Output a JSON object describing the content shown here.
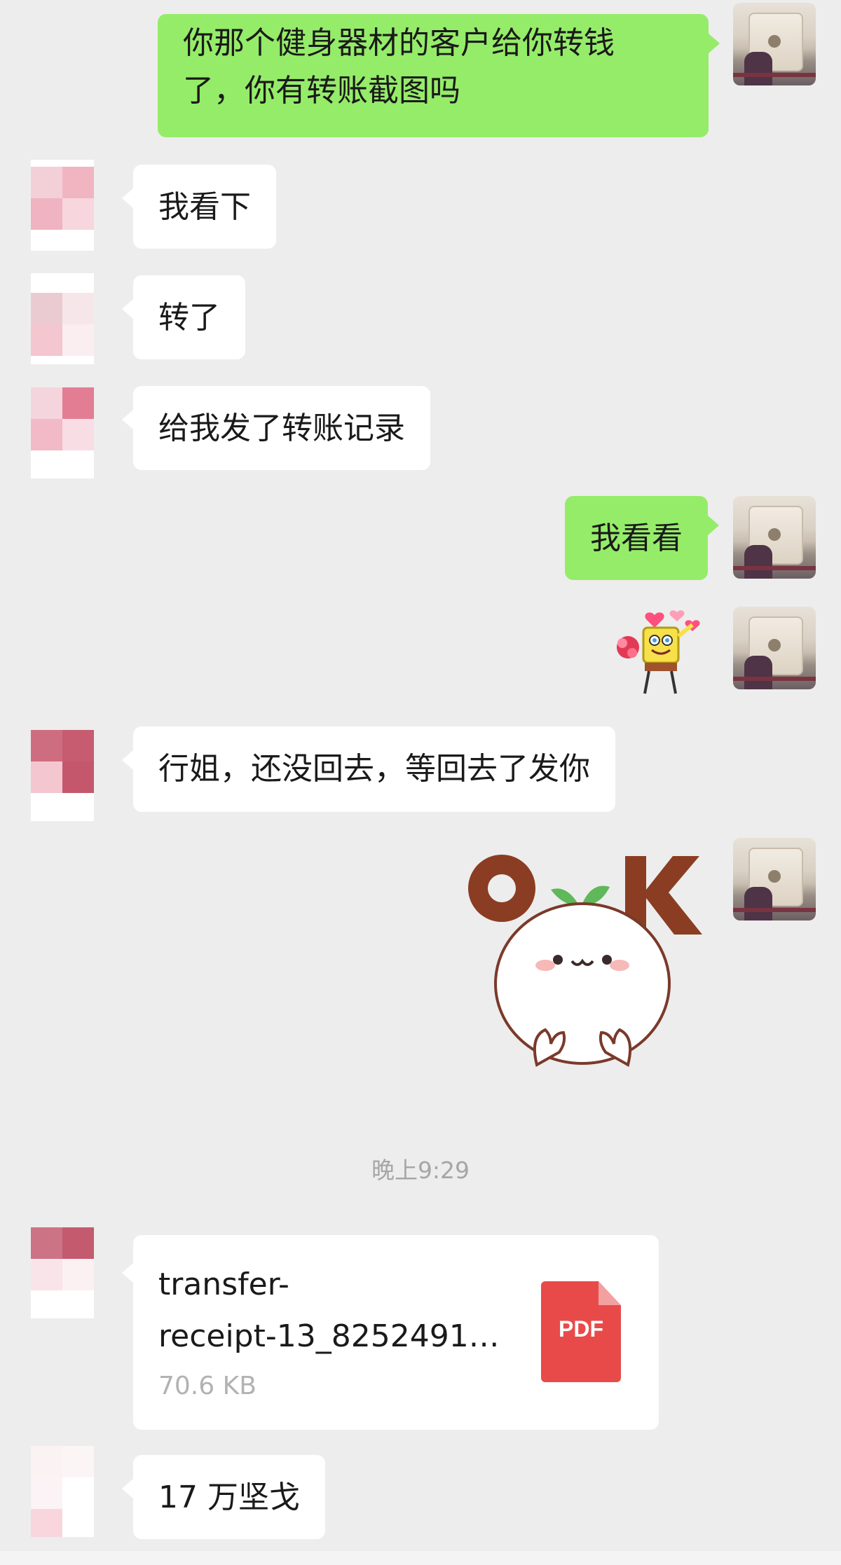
{
  "messages": {
    "m1": "你那个健身器材的客户给你转钱了，你有转账截图吗",
    "m1_line1": "你那个健身器材的客户给你转钱",
    "m1_line2": "了，你有转账截图吗",
    "m2": "我看下",
    "m3": "转了",
    "m4": "给我发了转账记录",
    "m5": "我看看",
    "m6": "行姐，还没回去，等回去了发你",
    "m8": "17 万坚戈"
  },
  "timestamp": "晚上9:29",
  "file": {
    "name_line1": "transfer-",
    "name_line2": "receipt-13_8252491…",
    "size": "70.6 KB",
    "type_label": "PDF"
  },
  "stickers": {
    "ok_letters": [
      "O",
      "K"
    ]
  },
  "colors": {
    "background": "#ededed",
    "bubble_out": "#95ec69",
    "bubble_in": "#ffffff",
    "pdf_red": "#e84a4a"
  }
}
